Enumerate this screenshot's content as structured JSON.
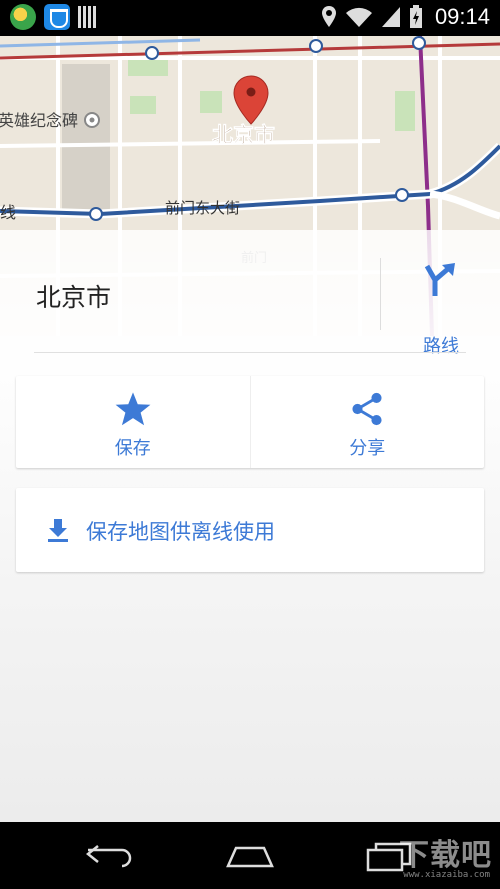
{
  "status_bar": {
    "time": "09:14",
    "icons": [
      "app-green-icon",
      "shield-app-icon",
      "barcode-icon",
      "location-icon",
      "wifi-icon",
      "signal-icon",
      "battery-icon"
    ]
  },
  "map": {
    "labels": {
      "monument": "英雄纪念碑",
      "city": "北京市",
      "street": "前门东大街",
      "line": "线",
      "qianmen": "前门"
    },
    "colors": {
      "land": "#ede7dc",
      "road_blue": "#2e5a9c",
      "road_red": "#b53a3a",
      "road_purple": "#8d2e8a",
      "pin": "#db4437"
    }
  },
  "place": {
    "title": "北京市",
    "route_label": "路线"
  },
  "actions": {
    "save_label": "保存",
    "share_label": "分享"
  },
  "offline": {
    "label": "保存地图供离线使用"
  },
  "watermark": {
    "text": "下载吧",
    "url": "www.xiazaiba.com"
  },
  "colors": {
    "accent": "#3d7ad6"
  }
}
